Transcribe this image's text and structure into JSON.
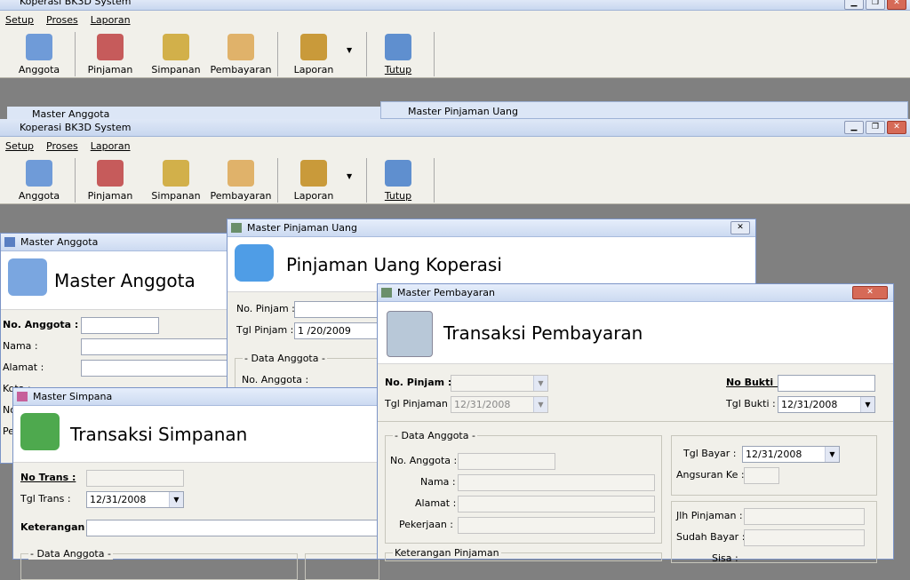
{
  "app": {
    "title": "Koperasi BK3D System",
    "menu": [
      "Setup",
      "Proses",
      "Laporan"
    ],
    "toolbar": [
      "Anggota",
      "Pinjaman",
      "Simpanan",
      "Pembayaran",
      "Laporan",
      "Tutup"
    ]
  },
  "back": {
    "anggota_title": "Master Anggota",
    "pinjaman_title": "Master Pinjaman Uang"
  },
  "anggota": {
    "title": "Master Anggota",
    "header": "Master Anggota",
    "no_label": "No. Anggota :",
    "nama": "Nama :",
    "alamat": "Alamat :",
    "kota": "Kota :",
    "no": "No",
    "pe": "Pe"
  },
  "pinjaman": {
    "title": "Master Pinjaman Uang",
    "header": "Pinjaman Uang Koperasi",
    "no_label": "No. Pinjam :",
    "tgl_label": "Tgl Pinjam :",
    "tgl_value": "1 /20/2009",
    "grp": "- Data Anggota -",
    "no_anggota": "No. Anggota :"
  },
  "simpanan": {
    "title": "Master Simpana",
    "header": "Transaksi Simpanan",
    "no_label": "No Trans :",
    "tgl_label": "Tgl Trans :",
    "tgl_value": "12/31/2008",
    "ket_label": "Keterangan :",
    "grp": "- Data Anggota -"
  },
  "bayar": {
    "title": "Master Pembayaran",
    "header": "Transaksi Pembayaran",
    "no_pinjam": "No. Pinjam :",
    "tgl_pinjam": "Tgl Pinjaman :",
    "tgl_pinjam_value": "12/31/2008",
    "no_bukti": "No Bukti :",
    "tgl_bukti": "Tgl Bukti :",
    "tgl_bukti_value": "12/31/2008",
    "grp_anggota": "- Data Anggota -",
    "no_anggota": "No. Anggota :",
    "nama": "Nama :",
    "alamat": "Alamat :",
    "pekerjaan": "Pekerjaan :",
    "tgl_bayar": "Tgl Bayar :",
    "tgl_bayar_value": "12/31/2008",
    "angsuran": "Angsuran Ke :",
    "jlh": "Jlh Pinjaman :",
    "sudah": "Sudah Bayar :",
    "sisa": "Sisa :",
    "ket": "Keterangan Pinjaman"
  }
}
